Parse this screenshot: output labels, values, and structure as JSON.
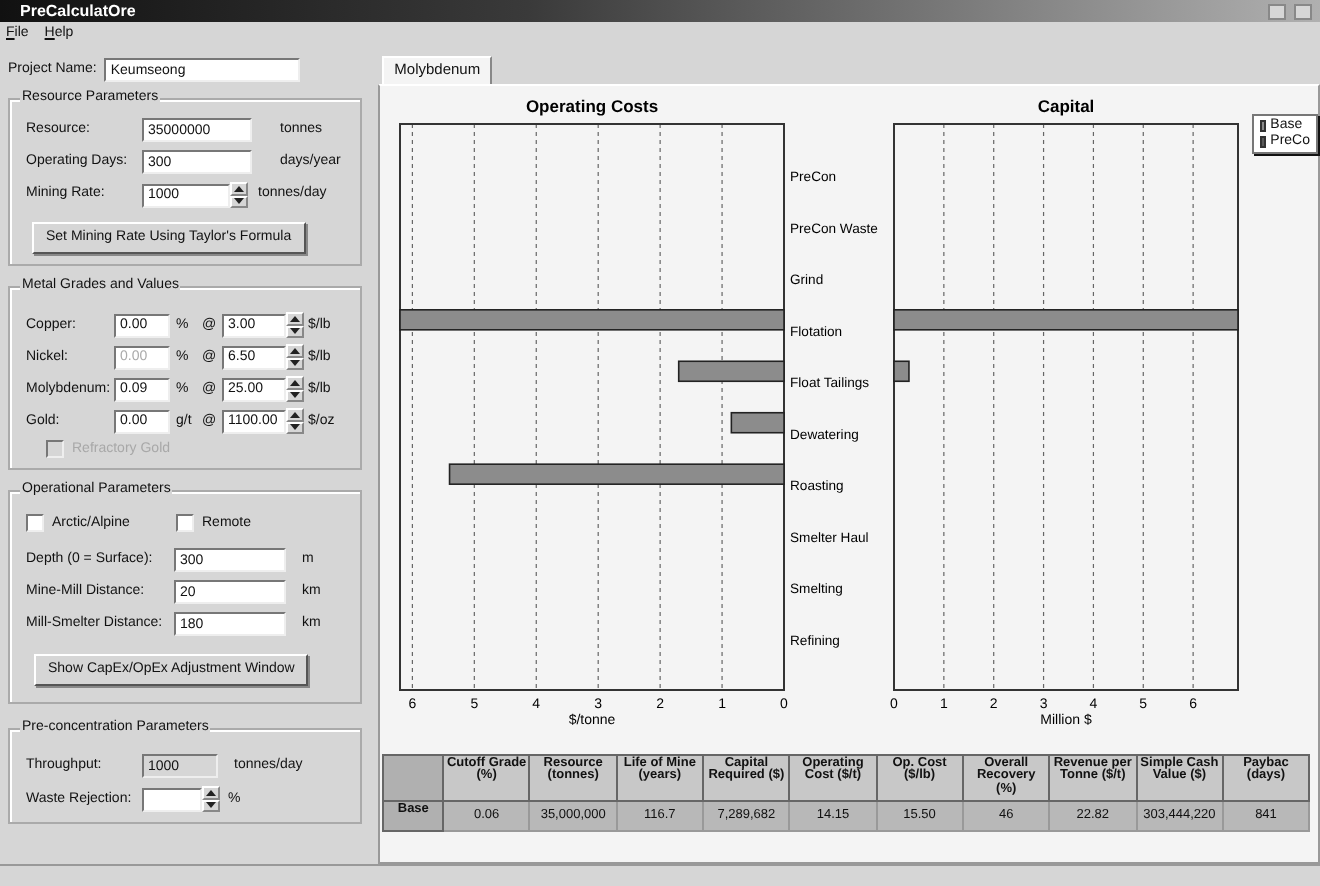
{
  "window": {
    "title": "PreCalculatOre"
  },
  "menu": [
    {
      "label": "File"
    },
    {
      "label": "Help"
    }
  ],
  "project_name": {
    "label": "Project Name:",
    "value": "Keumseong"
  },
  "resource_parameters": {
    "title": "Resource Parameters",
    "fields": [
      {
        "label": "Resource:",
        "value": "35000000",
        "unit": "tonnes",
        "spinner": false
      },
      {
        "label": "Operating Days:",
        "value": "300",
        "unit": "days/year",
        "spinner": false
      },
      {
        "label": "Mining Rate:",
        "value": "1000",
        "unit": "tonnes/day",
        "spinner": true
      }
    ],
    "button": "Set Mining Rate Using Taylor's Formula"
  },
  "metal_grades": {
    "title": "Metal Grades and Values",
    "metals": [
      {
        "label": "Copper:",
        "grade": "0.00",
        "disabled": false,
        "grade_unit": "%",
        "at": "@",
        "price": "3.00",
        "price_unit": "$/lb"
      },
      {
        "label": "Nickel:",
        "grade": "0.00",
        "disabled": true,
        "grade_unit": "%",
        "at": "@",
        "price": "6.50",
        "price_unit": "$/lb"
      },
      {
        "label": "Molybdenum:",
        "grade": "0.09",
        "disabled": false,
        "grade_unit": "%",
        "at": "@",
        "price": "25.00",
        "price_unit": "$/lb"
      },
      {
        "label": "Gold:",
        "grade": "0.00",
        "disabled": false,
        "grade_unit": "g/t",
        "at": "@",
        "price": "1100.00",
        "price_unit": "$/oz"
      }
    ],
    "refractory": {
      "label": "Refractory Gold",
      "checked": false,
      "disabled": true
    }
  },
  "operational_parameters": {
    "title": "Operational Parameters",
    "checkboxes": [
      {
        "label": "Arctic/Alpine",
        "checked": false
      },
      {
        "label": "Remote",
        "checked": false
      }
    ],
    "fields": [
      {
        "label": "Depth (0 = Surface):",
        "value": "300",
        "unit": "m"
      },
      {
        "label": "Mine-Mill Distance:",
        "value": "20",
        "unit": "km"
      },
      {
        "label": "Mill-Smelter Distance:",
        "value": "180",
        "unit": "km"
      }
    ],
    "button": "Show CapEx/OpEx Adjustment Window"
  },
  "preconcentration_parameters": {
    "title": "Pre-concentration Parameters",
    "fields": [
      {
        "label": "Throughput:",
        "value": "1000",
        "unit": "tonnes/day",
        "readonly": true,
        "spinner": false
      },
      {
        "label": "Waste Rejection:",
        "unit": "%",
        "readonly": false,
        "spinner": true
      }
    ]
  },
  "tabs": [
    {
      "label": "Molybdenum",
      "selected": true
    }
  ],
  "operating_chart": {
    "chart_data": {
      "type": "bar",
      "orientation": "horizontal",
      "title": "Operating Costs",
      "xlabel": "$/tonne",
      "categories": [
        "PreCon",
        "PreCon Waste",
        "Grind",
        "Flotation",
        "Float Tailings",
        "Dewatering",
        "Roasting",
        "Smelter Haul",
        "Smelting",
        "Refining"
      ],
      "series": [
        {
          "color": "#8c8c8c",
          "values": [
            null,
            null,
            null,
            6.2,
            1.7,
            0.85,
            5.4,
            null,
            null,
            null
          ]
        }
      ],
      "xlim": [
        6.2,
        0
      ],
      "xticks": [
        6,
        5,
        4,
        3,
        2,
        1,
        0
      ],
      "grid": true
    }
  },
  "capital_chart": {
    "chart_data": {
      "type": "bar",
      "orientation": "horizontal",
      "title": "Capital",
      "xlabel": "Million $",
      "series": [
        {
          "color": "#8c8c8c",
          "values": [
            null,
            null,
            null,
            6.9,
            0.3,
            null,
            null,
            null,
            null,
            null
          ]
        }
      ],
      "xlim": [
        0,
        6.9
      ],
      "xticks": [
        0,
        1,
        2,
        3,
        4,
        5,
        6
      ],
      "grid": true
    },
    "legend": [
      {
        "label": "Base",
        "color": "#8c8c8c"
      },
      {
        "label": "PreCo",
        "color": "#5a5a5a"
      }
    ]
  },
  "table": {
    "columns": [
      "Cutoff Grade (%)",
      "Resource (tonnes)",
      "Life of Mine (years)",
      "Capital Required ($)",
      "Operating Cost ($/t)",
      "Op. Cost ($/lb)",
      "Overall Recovery (%)",
      "Revenue per Tonne ($/t)",
      "Simple Cash Value ($)",
      "Paybac (days)"
    ],
    "rows": [
      {
        "header": "Base",
        "cells": [
          "0.06",
          "35,000,000",
          "116.7",
          "7,289,682",
          "14.15",
          "15.50",
          "46",
          "22.82",
          "303,444,220",
          "841"
        ]
      }
    ]
  }
}
